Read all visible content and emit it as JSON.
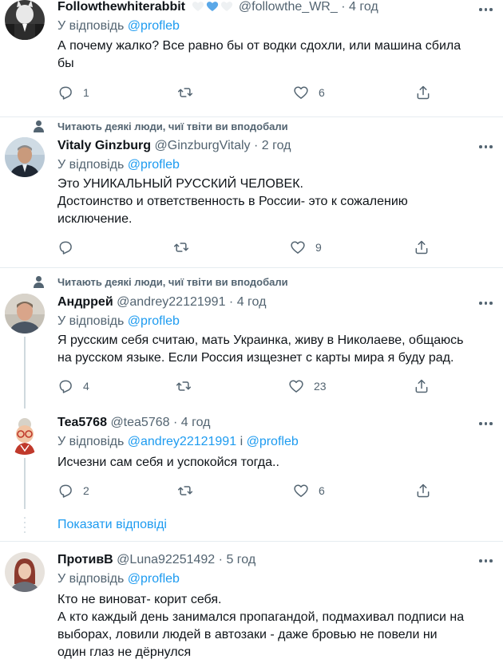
{
  "icons": {
    "reply": "reply-icon",
    "retweet": "retweet-icon",
    "like": "heart-icon",
    "share": "share-icon",
    "more": "more-dots-icon",
    "social_context": "person-icon"
  },
  "colors": {
    "accent": "#1d9bf0",
    "secondary_text": "#536471",
    "divider": "#e6ecf0"
  },
  "social_context_label": "Читають деякі люди, чиї твіти ви вподобали",
  "show_replies_label": "Показати відповіді",
  "tweets": [
    {
      "name": "Followthewhiterabbit",
      "handle": "@followthe_WR_",
      "dot": "·",
      "time": "4 год",
      "replying_prefix": "У відповідь",
      "mentions": [
        "@profleb"
      ],
      "lines": [
        "А почему жалко? Все равно бы от водки сдохли, или машина сбила",
        "бы"
      ],
      "replies": "1",
      "retweets": "",
      "likes": "6"
    },
    {
      "name": "Vitaly Ginzburg",
      "handle": "@GinzburgVitaly",
      "dot": "·",
      "time": "2 год",
      "replying_prefix": "У відповідь",
      "mentions": [
        "@profleb"
      ],
      "lines": [
        "Это УНИКАЛЬНЫЙ РУССКИЙ ЧЕЛОВЕК.",
        "Достоинство и ответственность в России- это к сожалению",
        "исключение."
      ],
      "replies": "",
      "retweets": "",
      "likes": "9"
    },
    {
      "name": "Андррей",
      "handle": "@andrey22121991",
      "dot": "·",
      "time": "4 год",
      "replying_prefix": "У відповідь",
      "mentions": [
        "@profleb"
      ],
      "lines": [
        "Я русским себя считаю, мать Украинка, живу в Николаеве, общаюсь",
        "на русском языке. Если Россия изщезнет с карты мира я буду рад."
      ],
      "replies": "4",
      "retweets": "",
      "likes": "23"
    },
    {
      "name": "Tea5768",
      "handle": "@tea5768",
      "dot": "·",
      "time": "4 год",
      "replying_prefix": "У відповідь",
      "mentions": [
        "@andrey22121991",
        "@profleb"
      ],
      "mention_joiner": "і",
      "lines": [
        "Исчезни сам себя и успокойся тогда.."
      ],
      "replies": "2",
      "retweets": "",
      "likes": "6"
    },
    {
      "name": "ПротивВ",
      "handle": "@Luna92251492",
      "dot": "·",
      "time": "5 год",
      "replying_prefix": "У відповідь",
      "mentions": [
        "@profleb"
      ],
      "lines": [
        "Кто не виноват- корит себя.",
        "А кто каждый день занимался пропагандой, подмахивал подписи на",
        "выборах, ловили людей в автозаки - даже бровью не повели ни",
        "один глаз не дёрнулся"
      ]
    }
  ]
}
